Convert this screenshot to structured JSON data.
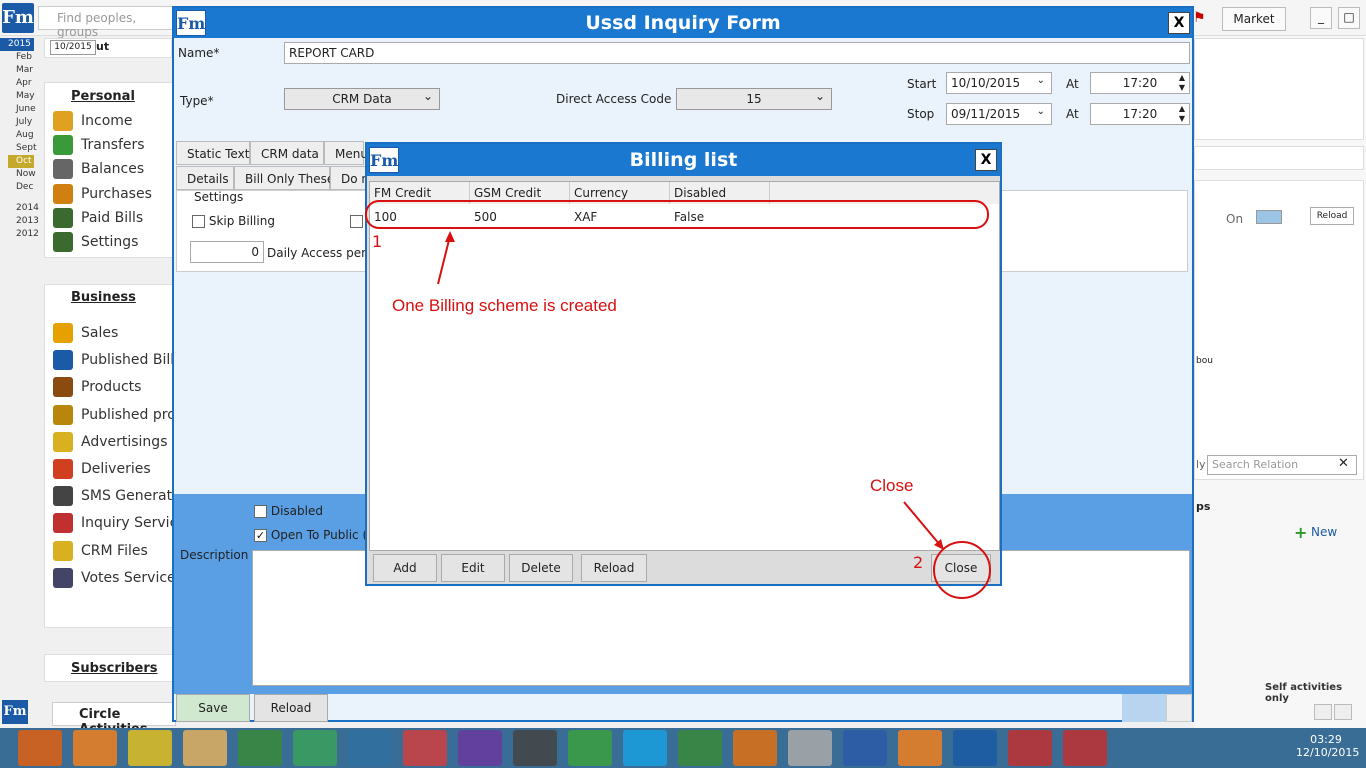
{
  "topbar": {
    "search_placeholder": "Find peoples, groups",
    "market_label": "Market"
  },
  "calendar": {
    "year_current": "2015",
    "date_field": "10/2015",
    "date_suffix": "ut",
    "months": [
      "Feb",
      "Mar",
      "Apr",
      "May",
      "June",
      "July",
      "Aug",
      "Sept",
      "Oct",
      "Now",
      "Dec"
    ],
    "selected_month": "Oct",
    "years": [
      "2014",
      "2013",
      "2012"
    ]
  },
  "personal": {
    "title": "Personal",
    "items": [
      "Income",
      "Transfers",
      "Balances",
      "Purchases",
      "Paid Bills",
      "Settings"
    ]
  },
  "business": {
    "title": "Business",
    "items": [
      "Sales",
      "Published Bills",
      "Products",
      "Published prod",
      "Advertisings",
      "Deliveries",
      "SMS Generato",
      "Inquiry Service",
      "CRM Files",
      "Votes Service"
    ]
  },
  "subscribers": {
    "title": "Subscribers"
  },
  "circle": {
    "label": "Circle Activities"
  },
  "form": {
    "title": "Ussd Inquiry Form",
    "name_label": "Name*",
    "name_value": "REPORT CARD",
    "type_label": "Type*",
    "type_value": "CRM Data",
    "dac_label": "Direct Access Code",
    "dac_value": "15",
    "start_label": "Start",
    "start_date": "10/10/2015",
    "stop_label": "Stop",
    "stop_date": "09/11/2015",
    "at_label": "At",
    "start_time": "17:20",
    "stop_time": "17:20",
    "tabs_row1": [
      "Static Text",
      "CRM data",
      "Menu"
    ],
    "tabs_row2": [
      "Details",
      "Bill Only These",
      "Do n"
    ],
    "settings_label": "Settings",
    "skip_billing": "Skip Billing",
    "daily_value": "0",
    "daily_label": "Daily Access permi",
    "disabled_label": "Disabled",
    "open_public_label": "Open To Public (I",
    "description_label": "Description",
    "save_label": "Save",
    "reload_label": "Reload"
  },
  "billing": {
    "title": "Billing list",
    "columns": [
      "FM Credit",
      "GSM Credit",
      "Currency",
      "Disabled"
    ],
    "rows": [
      [
        "100",
        "500",
        "XAF",
        "False"
      ]
    ],
    "buttons": [
      "Add",
      "Edit",
      "Delete",
      "Reload"
    ],
    "close_label": "Close"
  },
  "annotations": {
    "marker1": "1",
    "marker2": "2",
    "created_note": "One Billing scheme is created",
    "close_note": "Close"
  },
  "right_panel": {
    "on_label": "On",
    "reload_label": "Reload",
    "bou_text": "bou",
    "ly_text": "ly",
    "search_relation": "Search Relation",
    "ps_text": "ps",
    "new_label": "New",
    "self_activities": "Self activities only"
  },
  "taskbar": {
    "time": "03:29",
    "date": "12/10/2015"
  }
}
